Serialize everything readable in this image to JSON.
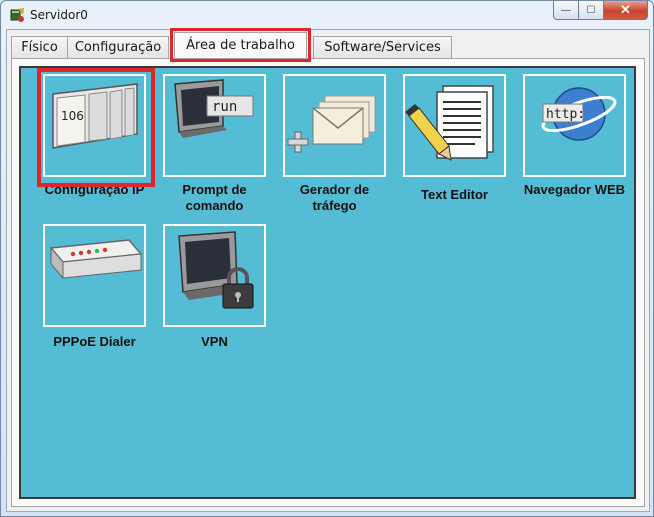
{
  "window": {
    "title": "Servidor0",
    "min_symbol": "—",
    "max_symbol": "☐",
    "close_symbol": "✕"
  },
  "tabs": [
    {
      "label": "Físico",
      "active": false
    },
    {
      "label": "Configuração",
      "active": false
    },
    {
      "label": "Área de trabalho",
      "active": true
    },
    {
      "label": "Software/Services",
      "active": false
    }
  ],
  "apps": [
    {
      "label": "Configuração IP",
      "icon": "ip-config-icon",
      "screen_text": "106",
      "highlighted": true
    },
    {
      "label": "Prompt de comando",
      "icon": "command-prompt-icon",
      "screen_text": "run"
    },
    {
      "label": "Gerador de tráfego",
      "icon": "traffic-generator-icon"
    },
    {
      "label": "Text Editor",
      "icon": "text-editor-icon"
    },
    {
      "label": "Navegador WEB",
      "icon": "web-browser-icon",
      "screen_text": "http:"
    },
    {
      "label": "PPPoE Dialer",
      "icon": "pppoe-dialer-icon"
    },
    {
      "label": "VPN",
      "icon": "vpn-icon"
    }
  ],
  "colors": {
    "desktop_bg": "#55bcd5",
    "highlight": "#e0262a"
  }
}
